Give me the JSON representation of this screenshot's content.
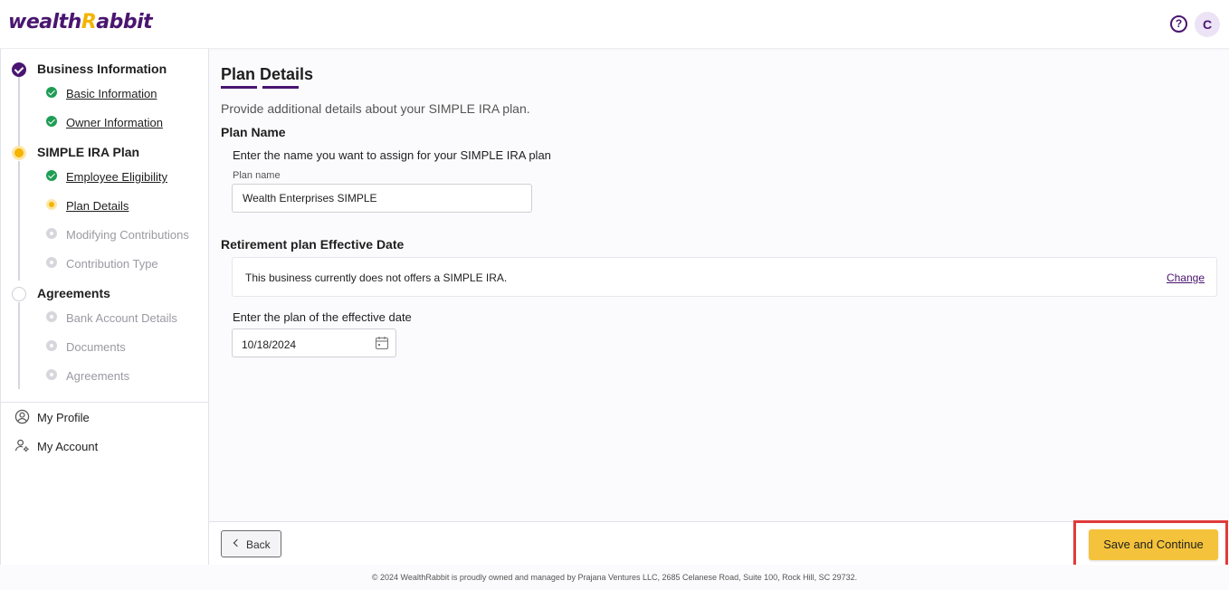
{
  "header": {
    "logo_text_1": "wealth",
    "logo_text_2": "R",
    "logo_text_3": "abbit",
    "help_symbol": "?",
    "avatar_initial": "C"
  },
  "sidebar": {
    "sections": [
      {
        "title": "Business Information",
        "status": "complete"
      },
      {
        "title": "SIMPLE IRA Plan",
        "status": "current"
      },
      {
        "title": "Agreements",
        "status": "pending"
      }
    ],
    "items": {
      "basic_information": {
        "label": "Basic Information",
        "status": "complete"
      },
      "owner_information": {
        "label": "Owner Information",
        "status": "complete"
      },
      "employee_eligibility": {
        "label": "Employee Eligibility",
        "status": "complete"
      },
      "plan_details": {
        "label": "Plan Details",
        "status": "current"
      },
      "modifying_contributions": {
        "label": "Modifying Contributions",
        "status": "disabled"
      },
      "contribution_type": {
        "label": "Contribution Type",
        "status": "disabled"
      },
      "bank_account_details": {
        "label": "Bank Account Details",
        "status": "disabled"
      },
      "documents": {
        "label": "Documents",
        "status": "disabled"
      },
      "agreements": {
        "label": "Agreements",
        "status": "disabled"
      }
    },
    "links": {
      "my_profile": "My Profile",
      "my_account": "My Account"
    }
  },
  "main": {
    "title": "Plan Details",
    "subtitle": "Provide additional details about your SIMPLE IRA plan.",
    "plan_name": {
      "heading": "Plan Name",
      "description": "Enter the name you want to assign for your SIMPLE IRA plan",
      "field_label": "Plan name",
      "value": "Wealth Enterprises SIMPLE"
    },
    "effective_date": {
      "heading": "Retirement plan Effective Date",
      "info_text": "This business currently does not offers a SIMPLE IRA.",
      "change_label": "Change",
      "description": "Enter the plan of the effective date",
      "value": "10/18/2024"
    }
  },
  "actions": {
    "back_label": "Back",
    "save_label": "Save and Continue"
  },
  "footer": {
    "copyright": "© 2024 WealthRabbit is proudly owned and managed by Prajana Ventures LLC, 2685 Celanese Road, Suite 100, Rock Hill, SC 29732."
  },
  "colors": {
    "brand_purple": "#4a1570",
    "accent_yellow": "#f5c33b",
    "success_green": "#1f9d55",
    "highlight_red": "#e03a3a"
  }
}
